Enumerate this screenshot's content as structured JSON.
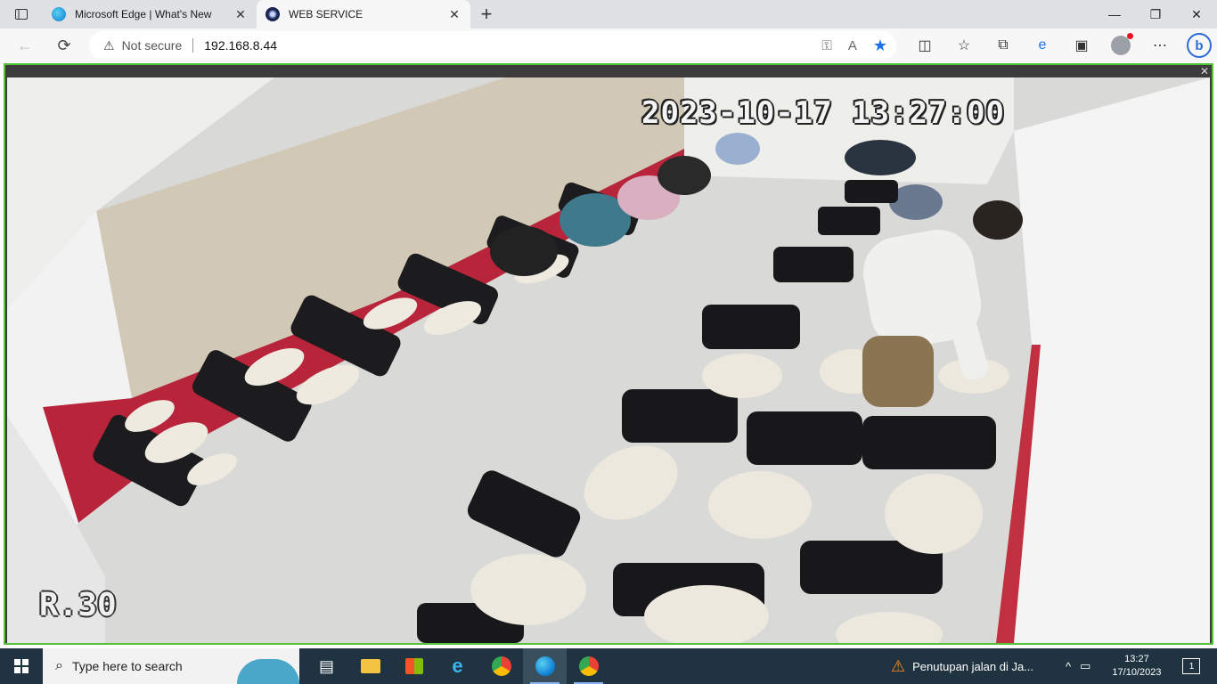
{
  "browser": {
    "tabs": [
      {
        "title": "Microsoft Edge | What's New",
        "favicon": "edge-icon",
        "active": false
      },
      {
        "title": "WEB SERVICE",
        "favicon": "camera-icon",
        "active": true
      }
    ],
    "new_tab": "+",
    "window_controls": {
      "minimize": "—",
      "restore": "❐",
      "close": "✕"
    },
    "nav": {
      "back": "←",
      "refresh": "⟳"
    },
    "address": {
      "security_text": "Not secure",
      "url": "192.168.8.44"
    },
    "toolbar_icons": [
      "split-screen-icon",
      "favorites-icon",
      "collections-icon",
      "edge-bar-icon",
      "browser-essentials-icon",
      "profile-icon",
      "more-icon",
      "bing-icon"
    ]
  },
  "viewer": {
    "close": "✕",
    "timestamp": "2023-10-17 13:27:00",
    "camera_label": "R.30"
  },
  "taskbar": {
    "search_placeholder": "Type here to search",
    "pinned": [
      "task-view-icon",
      "file-explorer-icon",
      "store-icon",
      "internet-explorer-icon",
      "chrome-icon",
      "edge-icon",
      "chrome-profile-icon"
    ],
    "news_text": "Penutupan jalan di Ja...",
    "clock_time": "13:27",
    "clock_date": "17/10/2023",
    "notification_count": "1"
  }
}
